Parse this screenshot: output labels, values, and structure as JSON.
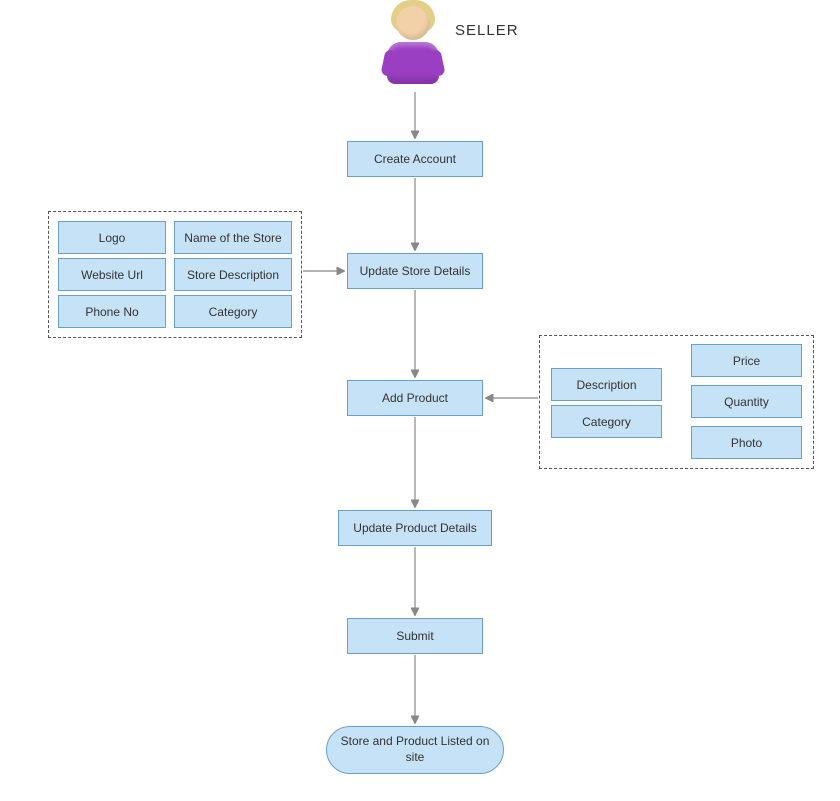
{
  "actorLabel": "SELLER",
  "flow": {
    "createAccount": "Create Account",
    "updateStore": "Update Store Details",
    "addProduct": "Add  Product",
    "updateProduct": "Update Product Details",
    "submit": "Submit",
    "terminator": "Store and Product Listed on site"
  },
  "storeFields": {
    "logo": "Logo",
    "storeName": "Name of the Store",
    "websiteUrl": "Website Url",
    "storeDescription": "Store Description",
    "phoneNo": "Phone No",
    "category": "Category"
  },
  "productFields": {
    "description": "Description",
    "category": "Category",
    "price": "Price",
    "quantity": "Quantity",
    "photo": "Photo"
  },
  "colors": {
    "nodeFill": "#c6e2f6",
    "nodeStroke": "#6aa0c8",
    "avatarShirt": "#9b3fc2"
  }
}
